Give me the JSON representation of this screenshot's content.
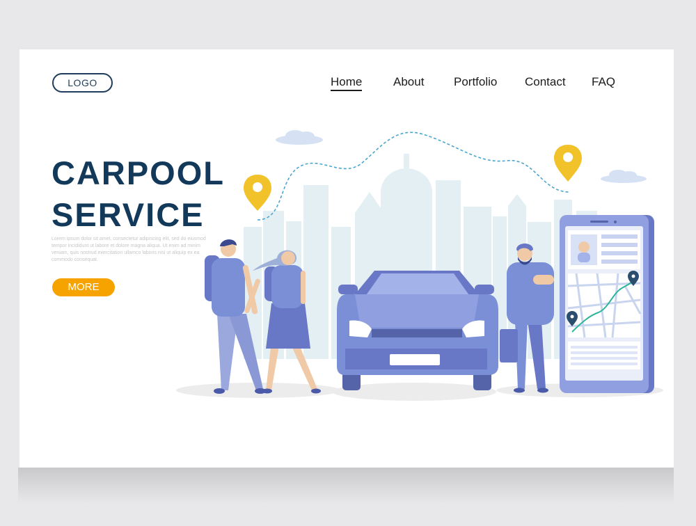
{
  "header": {
    "logo_label": "LOGO",
    "nav": [
      {
        "label": "Home",
        "active": true
      },
      {
        "label": "About",
        "active": false
      },
      {
        "label": "Portfolio",
        "active": false
      },
      {
        "label": "Contact",
        "active": false
      },
      {
        "label": "FAQ",
        "active": false
      }
    ]
  },
  "hero": {
    "title_line1": "CARPOOL",
    "title_line2": "SERVICE",
    "description": "Lorem ipsum dolor sit amet, consectetur adipiscing elit, sed do eiusmod tempor incididunt ut labore et dolore magna aliqua. Ut enim ad minim veniam, quis nostrud exercitation ullamco laboris nisi ut aliquip ex ea commodo consequat.",
    "more_label": "MORE"
  },
  "colors": {
    "accent": "#f6a300",
    "title": "#13395a",
    "illustration_blue": "#7b8fd6",
    "pin_yellow": "#f2c22a",
    "city": "#e3eef3"
  }
}
